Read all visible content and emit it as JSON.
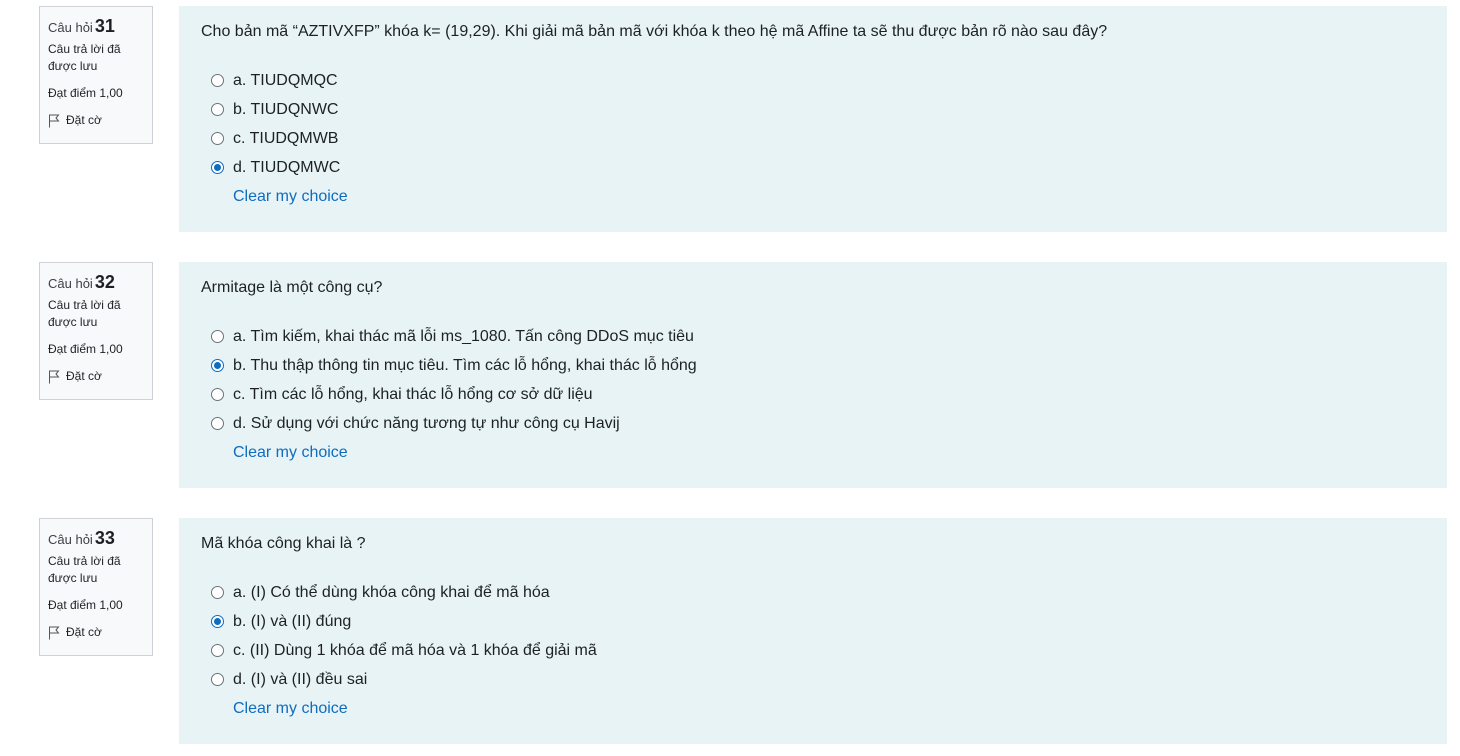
{
  "questions": [
    {
      "label": "Câu hỏi",
      "number": "31",
      "state": "Câu trả lời đã được lưu",
      "grade": "Đạt điểm 1,00",
      "flag": "Đặt cờ",
      "text": "Cho bản mã “AZTIVXFP” khóa k= (19,29). Khi giải mã bản mã với khóa k theo hệ mã Affine ta sẽ thu được bản rõ nào sau đây?",
      "answers": [
        "a. TIUDQMQC",
        "b. TIUDQNWC",
        "c. TIUDQMWB",
        "d. TIUDQMWC"
      ],
      "selected": 3,
      "clear": "Clear my choice"
    },
    {
      "label": "Câu hỏi",
      "number": "32",
      "state": "Câu trả lời đã được lưu",
      "grade": "Đạt điểm 1,00",
      "flag": "Đặt cờ",
      "text": "Armitage là một công cụ?",
      "answers": [
        "a. Tìm kiếm, khai thác mã lỗi ms_1080. Tấn công DDoS mục tiêu",
        "b. Thu thập thông tin mục tiêu. Tìm các lỗ hổng, khai thác lỗ hổng",
        "c. Tìm các lỗ hổng, khai thác lỗ hổng cơ sở dữ liệu",
        "d. Sử dụng với chức năng tương tự như công cụ Havij"
      ],
      "selected": 1,
      "clear": "Clear my choice"
    },
    {
      "label": "Câu hỏi",
      "number": "33",
      "state": "Câu trả lời đã được lưu",
      "grade": "Đạt điểm 1,00",
      "flag": "Đặt cờ",
      "text": "Mã khóa công khai là ?",
      "answers": [
        "a. (I) Có thể dùng khóa công khai để mã hóa",
        "b. (I) và (II) đúng",
        "c. (II) Dùng 1 khóa để mã hóa và 1 khóa để giải mã",
        "d. (I) và (II) đều sai"
      ],
      "selected": 1,
      "clear": "Clear my choice"
    }
  ]
}
